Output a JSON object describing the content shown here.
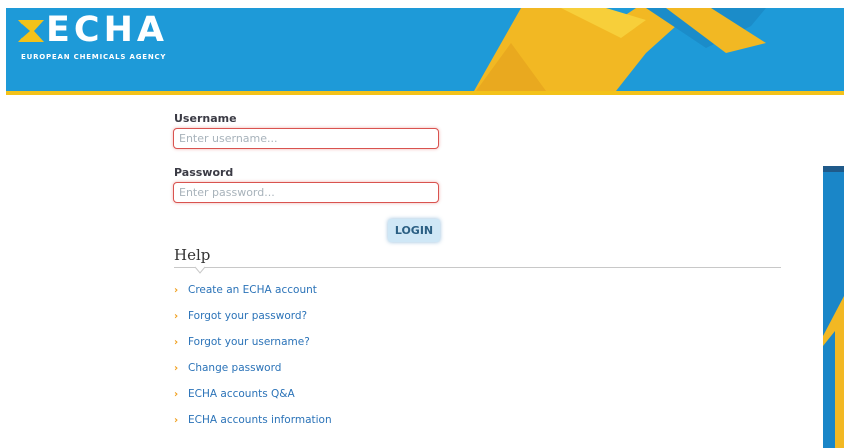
{
  "header": {
    "logo_text": "ECHA",
    "logo_subtitle": "EUROPEAN CHEMICALS AGENCY",
    "brand_colors": {
      "blue": "#1e9ad8",
      "yellow": "#f3c21a"
    },
    "icons": [
      "echa-logo-mark-icon"
    ]
  },
  "login_form": {
    "username_label": "Username",
    "username_placeholder": "Enter username...",
    "password_label": "Password",
    "password_placeholder": "Enter password...",
    "login_label": "LOGIN",
    "error_border_color": "#d9534f"
  },
  "help": {
    "heading": "Help",
    "links": [
      {
        "label": "Create an ECHA account"
      },
      {
        "label": "Forgot your password?"
      },
      {
        "label": "Forgot your username?"
      },
      {
        "label": "Change password"
      },
      {
        "label": "ECHA accounts Q&A"
      },
      {
        "label": "ECHA accounts information"
      }
    ],
    "link_icon": "chevron-right-icon",
    "link_color": "#2b73b8",
    "chevron_color": "#f0a020"
  }
}
